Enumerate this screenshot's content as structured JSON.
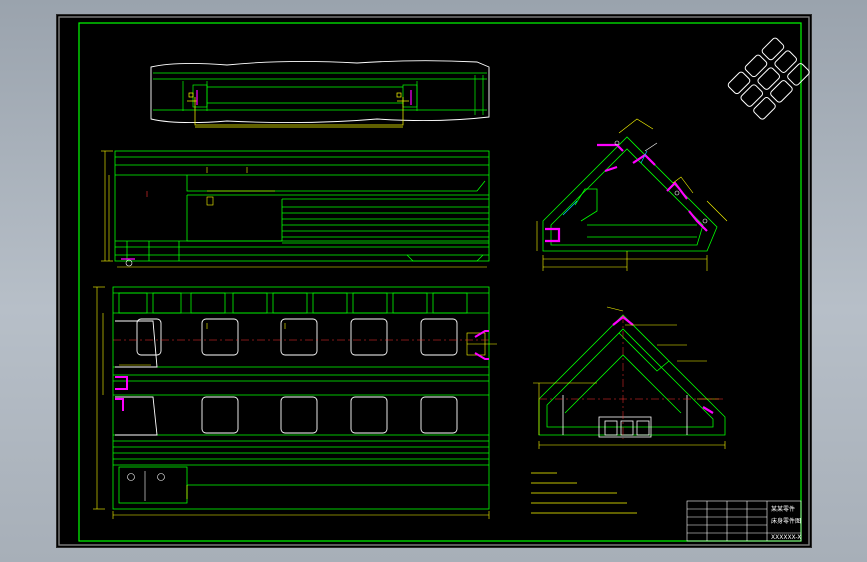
{
  "title_block": {
    "title_line1": "某某零件",
    "title_line2": "床身零件图",
    "drawing_number": "XXXXXX-X"
  },
  "colors": {
    "background": "#000000",
    "outline": "#00ff00",
    "dimension": "#ffff00",
    "hatch": "#ff00ff",
    "text": "#ffffff",
    "centerline": "#ff3333"
  }
}
